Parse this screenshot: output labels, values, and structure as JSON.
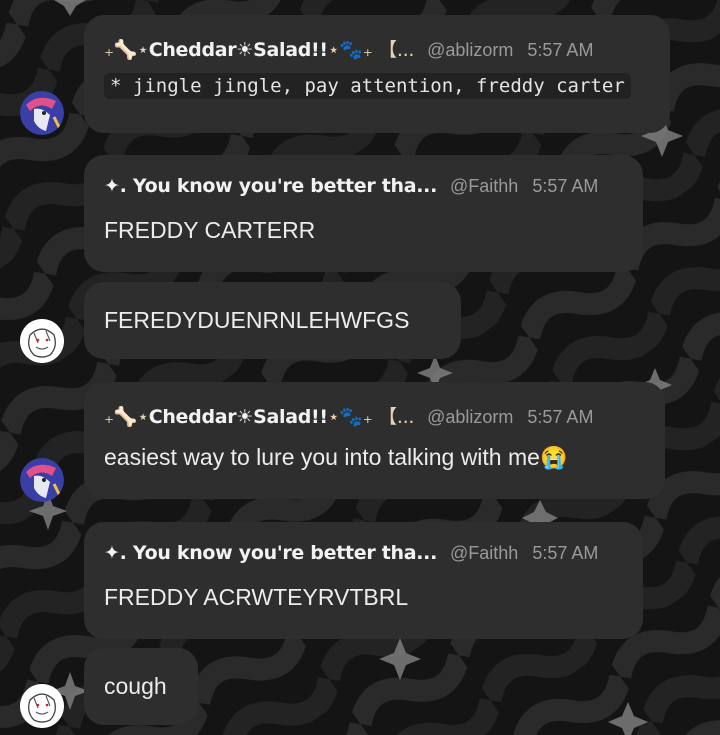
{
  "messages": [
    {
      "author": {
        "display_name_prefix": "₊🦴⋆",
        "display_name": "Cheddar☀Salad!!",
        "display_name_suffix": "⋆🐾₊ 【...",
        "handle": "@ablizorm"
      },
      "timestamp": "5:57 AM",
      "code": "* jingle jingle, pay attention, freddy carter"
    },
    {
      "author": {
        "display_name_prefix": "✦",
        "display_name": ". You know you're better tha...",
        "handle": "@Faithh"
      },
      "timestamp": "5:57 AM",
      "text": "FREDDY CARTERR"
    },
    {
      "text": "FEREDYDUENRNLEHWFGS"
    },
    {
      "author": {
        "display_name_prefix": "₊🦴⋆",
        "display_name": "Cheddar☀Salad!!",
        "display_name_suffix": "⋆🐾₊ 【...",
        "handle": "@ablizorm"
      },
      "timestamp": "5:57 AM",
      "text": "easiest way to lure you into talking with me",
      "emoji": "😭"
    },
    {
      "author": {
        "display_name_prefix": "✦",
        "display_name": ". You know you're better tha...",
        "handle": "@Faithh"
      },
      "timestamp": "5:57 AM",
      "text": "FREDDY ACRWTEYRVTBRL"
    },
    {
      "text": "cough"
    }
  ],
  "avatars": [
    "pink-blue-drawing-avatar",
    "white-sketch-avatar"
  ],
  "colors": {
    "background": "#141414",
    "bubble": "#2e2e2e",
    "code_bg": "#222222",
    "muted_text": "#9a9a9a"
  }
}
